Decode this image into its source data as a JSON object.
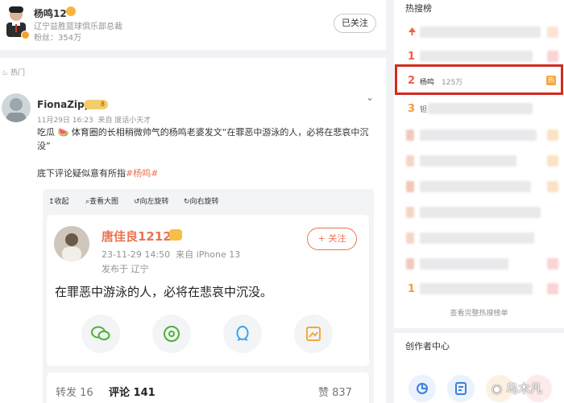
{
  "profile": {
    "name": "杨鸣12",
    "title": "辽宁益胜篮球俱乐部总裁",
    "followers_label": "粉丝：",
    "followers": "354万",
    "follow_status": "已关注"
  },
  "section": {
    "label": "热门"
  },
  "post": {
    "author": "FionaZipp",
    "level_badge": "8",
    "time": "11月29日 16:23",
    "source": "来自 度话小天才",
    "text_line1": "吃瓜 🍉 体育圈的长相稍微帅气的杨鸣老婆发文“在罪恶中游泳的人，必将在悲哀中沉",
    "text_line2": "没”",
    "text_line3_prefix": "底下评论疑似意有所指",
    "hashtag": "#杨鸣#",
    "image_toolbar": [
      "收起",
      "查看大图",
      "向左旋转",
      "向右旋转"
    ]
  },
  "embedded": {
    "author": "唐佳良1212",
    "time": "23-11-29 14:50",
    "device": "来自 iPhone 13",
    "location": "发布于 辽宁",
    "follow": "+ 关注",
    "text": "在罪恶中游泳的人，必将在悲哀中沉没。",
    "repost": "转发 16",
    "comment": "评论 141",
    "like": "赞 837",
    "colors": {
      "wechat": "#49b233",
      "moments": "#49b233",
      "qq": "#3ba4f0",
      "save": "#f3a93b"
    }
  },
  "hot": {
    "title": "热搜榜",
    "rows": [
      {
        "rank": "",
        "icon": "pin-icon"
      },
      {
        "rank": "1"
      },
      {
        "rank": "2",
        "name": "杨鸣",
        "count": "125万",
        "badge": "热"
      },
      {
        "rank": "3",
        "partial": "钽"
      },
      {
        "rank": ""
      },
      {
        "rank": ""
      },
      {
        "rank": ""
      },
      {
        "rank": ""
      },
      {
        "rank": ""
      },
      {
        "rank": ""
      },
      {
        "rank": "1"
      }
    ],
    "view_all": "查看完整热搜榜单"
  },
  "creator": {
    "title": "创作者中心"
  },
  "watermark": "乌木凡"
}
